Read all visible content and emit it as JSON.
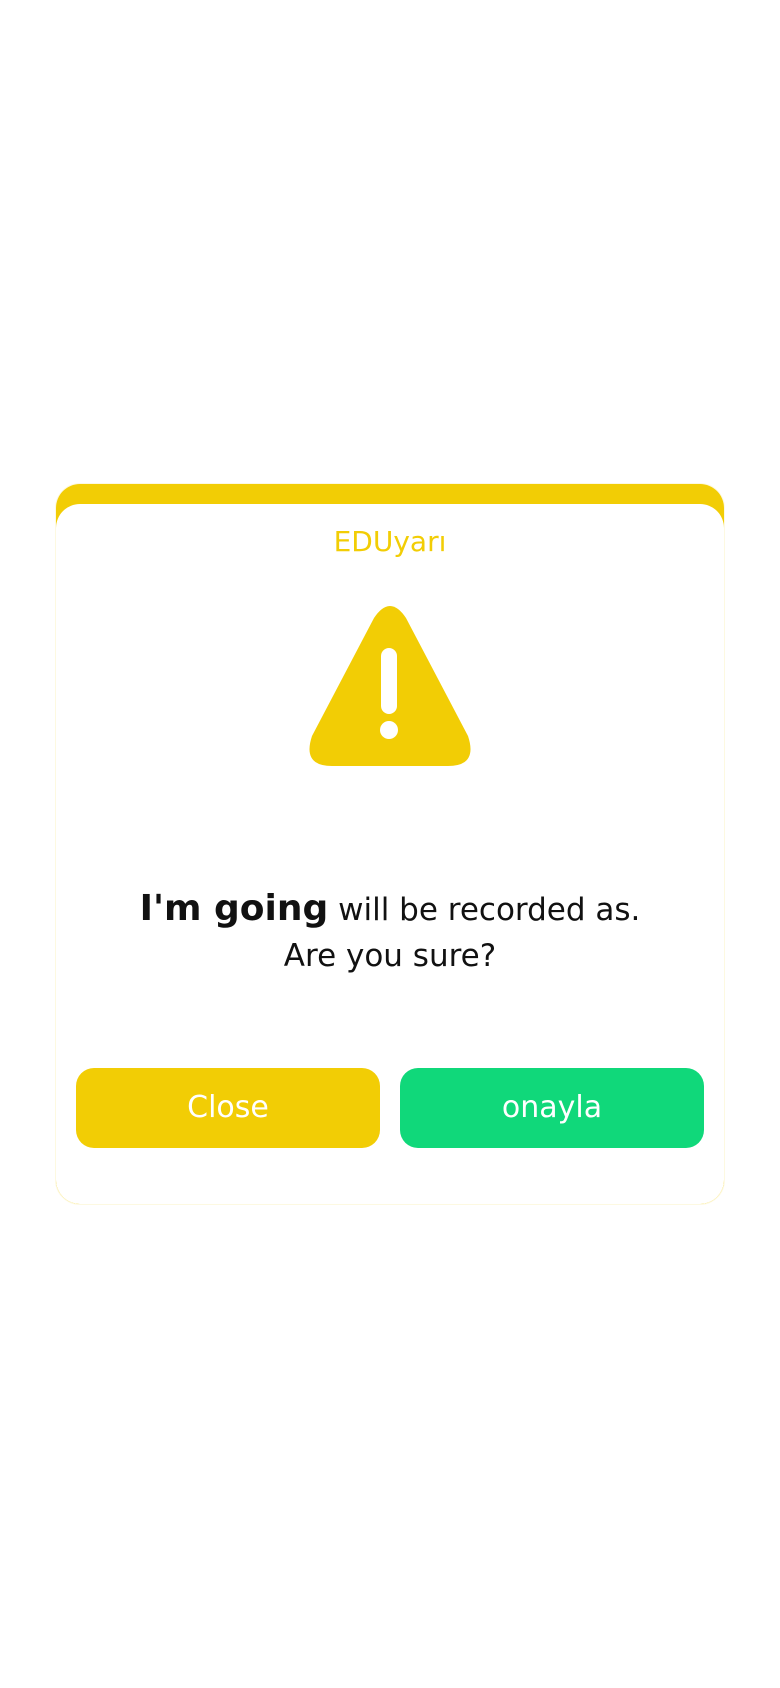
{
  "dialog": {
    "title": "EDUyarı",
    "icon": "warning-icon",
    "message": {
      "emphasis": "I'm going",
      "rest": " will be recorded as.",
      "question": "Are you sure?"
    },
    "buttons": {
      "close_label": "Close",
      "confirm_label": "onayla"
    }
  },
  "colors": {
    "accent": "#f2cd05",
    "confirm": "#10d87a",
    "text": "#111111",
    "background": "#ffffff"
  }
}
